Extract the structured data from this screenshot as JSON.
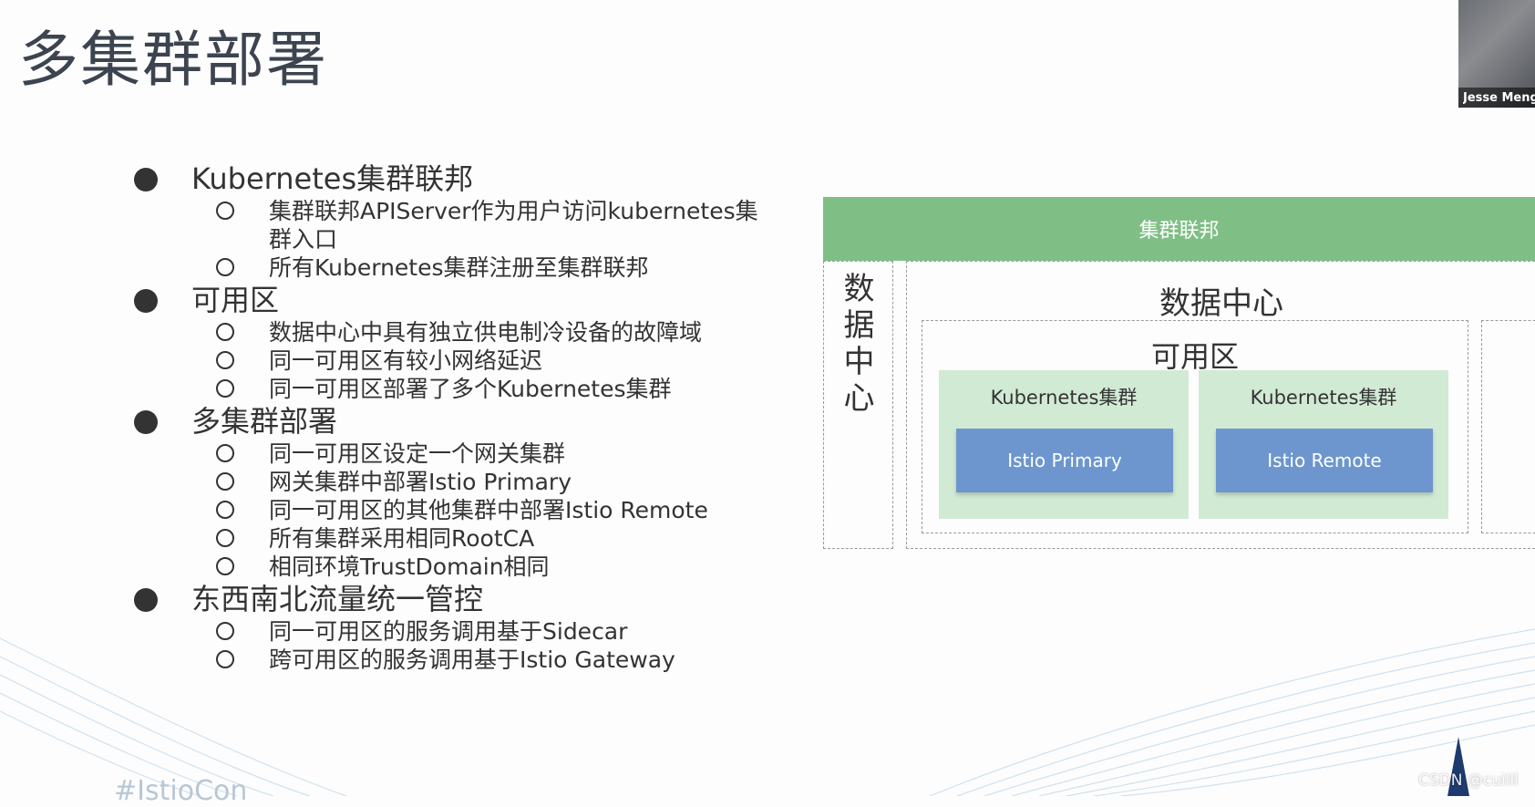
{
  "slide": {
    "title": "多集群部署",
    "hashtag": "#IstioCon",
    "watermark": "CSDN @cuilll"
  },
  "bullets": [
    {
      "text": "Kubernetes集群联邦",
      "children": [
        "集群联邦APIServer作为用户访问kubernetes集群入口",
        "所有Kubernetes集群注册至集群联邦"
      ]
    },
    {
      "text": "可用区",
      "children": [
        "数据中心中具有独立供电制冷设备的故障域",
        "同一可用区有较小网络延迟",
        "同一可用区部署了多个Kubernetes集群"
      ]
    },
    {
      "text": "多集群部署",
      "children": [
        "同一可用区设定一个网关集群",
        "网关集群中部署Istio Primary",
        "同一可用区的其他集群中部署Istio Remote",
        "所有集群采用相同RootCA",
        "相同环境TrustDomain相同"
      ]
    },
    {
      "text": "东西南北流量统一管控",
      "children": [
        "同一可用区的服务调用基于Sidecar",
        "跨可用区的服务调用基于Istio Gateway"
      ]
    }
  ],
  "diagram": {
    "federation": "集群联邦",
    "datacenter_side": "数据中心",
    "datacenter_main": "数据中心",
    "availability_zone": "可用区",
    "clusters": [
      {
        "label": "Kubernetes集群",
        "istio": "Istio Primary"
      },
      {
        "label": "Kubernetes集群",
        "istio": "Istio Remote"
      }
    ]
  },
  "webcam": {
    "name": "Jesse Meng"
  },
  "colors": {
    "federation_bar": "#7fbf86",
    "cluster_box": "#d1ead4",
    "istio_box": "#6d96ce"
  }
}
